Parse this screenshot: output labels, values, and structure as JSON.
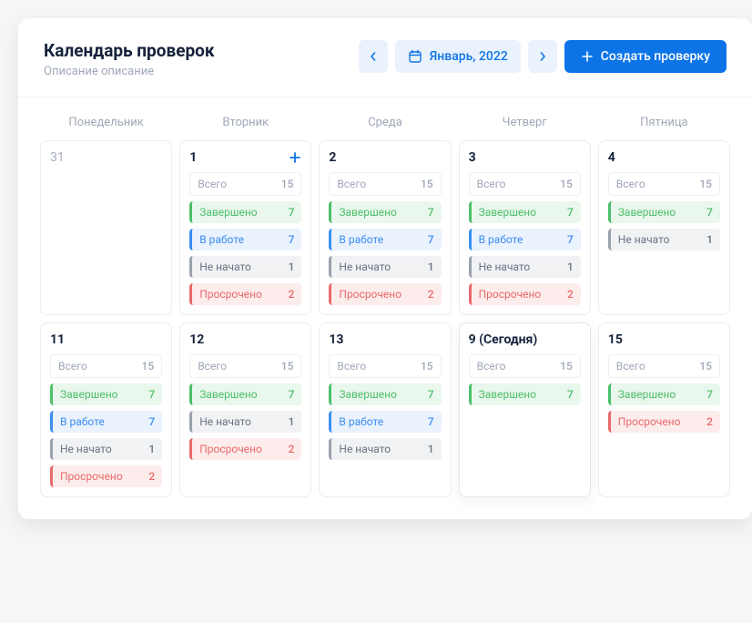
{
  "header": {
    "title": "Календарь проверок",
    "subtitle": "Описание описание",
    "month": "Январь, 2022",
    "create": "Создать проверку"
  },
  "weekdays": [
    "Понедельник",
    "Вторник",
    "Среда",
    "Четверг",
    "Пятница"
  ],
  "labels": {
    "total": "Всего",
    "done": "Завершено",
    "progress": "В работе",
    "notstarted": "Не начато",
    "overdue": "Просрочено"
  },
  "days": [
    {
      "num": "31",
      "muted": true,
      "stats": []
    },
    {
      "num": "1",
      "add": true,
      "stats": [
        {
          "type": "total",
          "count": 15
        },
        {
          "type": "done",
          "count": 7
        },
        {
          "type": "progress",
          "count": 7
        },
        {
          "type": "notstarted",
          "count": 1
        },
        {
          "type": "overdue",
          "count": 2
        }
      ]
    },
    {
      "num": "2",
      "stats": [
        {
          "type": "total",
          "count": 15
        },
        {
          "type": "done",
          "count": 7
        },
        {
          "type": "progress",
          "count": 7
        },
        {
          "type": "notstarted",
          "count": 1
        },
        {
          "type": "overdue",
          "count": 2
        }
      ]
    },
    {
      "num": "3",
      "stats": [
        {
          "type": "total",
          "count": 15
        },
        {
          "type": "done",
          "count": 7
        },
        {
          "type": "progress",
          "count": 7
        },
        {
          "type": "notstarted",
          "count": 1
        },
        {
          "type": "overdue",
          "count": 2
        }
      ]
    },
    {
      "num": "4",
      "stats": [
        {
          "type": "total",
          "count": 15
        },
        {
          "type": "done",
          "count": 7
        },
        {
          "type": "notstarted",
          "count": 1
        }
      ]
    },
    {
      "num": "11",
      "stats": [
        {
          "type": "total",
          "count": 15
        },
        {
          "type": "done",
          "count": 7
        },
        {
          "type": "progress",
          "count": 7
        },
        {
          "type": "notstarted",
          "count": 1
        },
        {
          "type": "overdue",
          "count": 2
        }
      ]
    },
    {
      "num": "12",
      "stats": [
        {
          "type": "total",
          "count": 15
        },
        {
          "type": "done",
          "count": 7
        },
        {
          "type": "notstarted",
          "count": 1
        },
        {
          "type": "overdue",
          "count": 2
        }
      ]
    },
    {
      "num": "13",
      "stats": [
        {
          "type": "total",
          "count": 15
        },
        {
          "type": "done",
          "count": 7
        },
        {
          "type": "progress",
          "count": 7
        },
        {
          "type": "notstarted",
          "count": 1
        }
      ]
    },
    {
      "num": "9 (Сегодня)",
      "today": true,
      "stats": [
        {
          "type": "total",
          "count": 15
        },
        {
          "type": "done",
          "count": 7
        }
      ]
    },
    {
      "num": "15",
      "stats": [
        {
          "type": "total",
          "count": 15
        },
        {
          "type": "done",
          "count": 7
        },
        {
          "type": "overdue",
          "count": 2
        }
      ]
    }
  ]
}
